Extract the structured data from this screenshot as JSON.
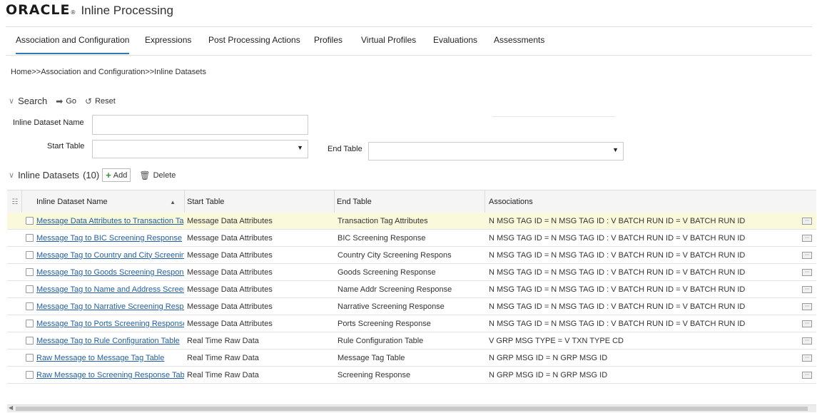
{
  "brand": {
    "logo": "ORACLE",
    "app_title": "Inline Processing"
  },
  "tabs": [
    {
      "label": "Association and Configuration",
      "active": true
    },
    {
      "label": "Expressions"
    },
    {
      "label": "Post Processing Actions"
    },
    {
      "label": "Profiles"
    },
    {
      "label": "Virtual Profiles"
    },
    {
      "label": "Evaluations"
    },
    {
      "label": "Assessments"
    }
  ],
  "breadcrumb": "Home>>Association and Configuration>>Inline Datasets",
  "search": {
    "title": "Search",
    "go_label": "Go",
    "reset_label": "Reset",
    "dataset_name_label": "Inline Dataset Name",
    "dataset_name_value": "",
    "start_table_label": "Start Table",
    "start_table_value": "",
    "end_table_label": "End Table",
    "end_table_value": ""
  },
  "datasets": {
    "title": "Inline Datasets",
    "count": "(10)",
    "add_label": "Add",
    "delete_label": "Delete",
    "columns": [
      "Inline Dataset Name",
      "Start Table",
      "End Table",
      "Associations"
    ],
    "rows": [
      {
        "name": "Message Data Attributes to Transaction Tag Attributes",
        "start": "Message Data Attributes",
        "end": "Transaction Tag Attributes",
        "assoc": "N MSG TAG ID = N MSG TAG ID : V BATCH RUN ID = V BATCH RUN ID"
      },
      {
        "name": "Message Tag to BIC Screening Response",
        "start": "Message Data Attributes",
        "end": "BIC Screening Response",
        "assoc": "N MSG TAG ID = N MSG TAG ID : V BATCH RUN ID = V BATCH RUN ID"
      },
      {
        "name": "Message Tag to Country and City Screening Response",
        "start": "Message Data Attributes",
        "end": "Country City Screening Respons",
        "assoc": "N MSG TAG ID = N MSG TAG ID : V BATCH RUN ID = V BATCH RUN ID"
      },
      {
        "name": "Message Tag to Goods Screening Response",
        "start": "Message Data Attributes",
        "end": "Goods Screening Response",
        "assoc": "N MSG TAG ID = N MSG TAG ID : V BATCH RUN ID = V BATCH RUN ID"
      },
      {
        "name": "Message Tag to Name and Address Screening Response",
        "start": "Message Data Attributes",
        "end": "Name Addr Screening Response",
        "assoc": "N MSG TAG ID = N MSG TAG ID : V BATCH RUN ID = V BATCH RUN ID"
      },
      {
        "name": "Message Tag to Narrative Screening Response",
        "start": "Message Data Attributes",
        "end": "Narrative Screening Response",
        "assoc": "N MSG TAG ID = N MSG TAG ID : V BATCH RUN ID = V BATCH RUN ID"
      },
      {
        "name": "Message Tag to Ports Screening Response",
        "start": "Message Data Attributes",
        "end": "Ports Screening Response",
        "assoc": "N MSG TAG ID = N MSG TAG ID : V BATCH RUN ID = V BATCH RUN ID"
      },
      {
        "name": "Message Tag to Rule Configuration Table",
        "start": "Real Time Raw Data",
        "end": "Rule Configuration Table",
        "assoc": "V GRP MSG TYPE = V TXN TYPE CD"
      },
      {
        "name": "Raw Message to Message Tag Table",
        "start": "Real Time Raw Data",
        "end": "Message Tag Table",
        "assoc": "N GRP MSG ID = N GRP MSG ID"
      },
      {
        "name": "Raw Message to Screening Response Table",
        "start": "Real Time Raw Data",
        "end": "Screening Response",
        "assoc": "N GRP MSG ID = N GRP MSG ID"
      }
    ]
  },
  "colors": {
    "link": "#1f5fa6",
    "accent": "#2f7bb8",
    "selected_row": "#fbf9dc"
  },
  "icons": {
    "go": "go-arrow-icon",
    "reset": "reset-icon",
    "add": "plus-icon",
    "delete": "trash-icon",
    "detail": "detail-icon"
  }
}
